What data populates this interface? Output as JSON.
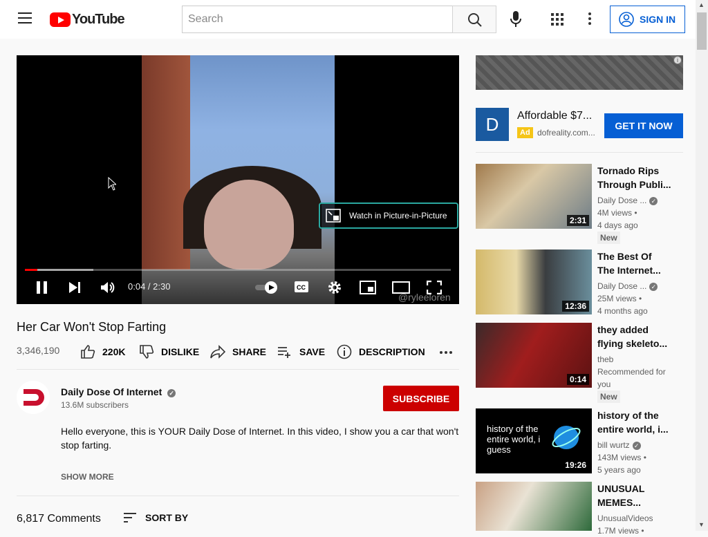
{
  "header": {
    "logo_text": "YouTube",
    "search_placeholder": "Search",
    "signin_label": "SIGN IN"
  },
  "player": {
    "time_display": "0:04 / 2:30",
    "pip_label": "Watch in Picture-in-Picture",
    "watermark": "@ryleeloren",
    "progress_played": 0.03,
    "progress_buffered": 0.16
  },
  "video": {
    "title": "Her Car Won't Stop Farting",
    "views": "3,346,190",
    "like_count": "220K",
    "dislike_label": "DISLIKE",
    "share_label": "SHARE",
    "save_label": "SAVE",
    "description_label": "DESCRIPTION"
  },
  "channel": {
    "name": "Daily Dose Of Internet",
    "subscribers": "13.6M subscribers",
    "subscribe_label": "SUBSCRIBE",
    "description": "Hello everyone, this is YOUR Daily Dose of Internet. In this video, I show you a car that won't stop farting.",
    "show_more": "SHOW MORE"
  },
  "comments": {
    "count": "6,817 Comments",
    "sort_label": "SORT BY"
  },
  "ad": {
    "logo_letter": "D",
    "title": "Affordable $7...",
    "tag": "Ad",
    "url": "dofreality.com...",
    "button_label": "GET IT NOW"
  },
  "related": [
    {
      "title1": "Tornado Rips",
      "title2": "Through Publi...",
      "channel": "Daily Dose ...",
      "views": "4M views",
      "age": "4 days ago",
      "duration": "2:31",
      "badge": "New"
    },
    {
      "title1": "The Best Of",
      "title2": "The Internet...",
      "channel": "Daily Dose ...",
      "views": "25M views",
      "age": "4 months ago",
      "duration": "12:36",
      "badge": ""
    },
    {
      "title1": "they added",
      "title2": "flying skeleto...",
      "channel": "theb",
      "views": "Recommended for",
      "age": "you",
      "duration": "0:14",
      "badge": "New"
    },
    {
      "title1": "history of the",
      "title2": "entire world, i...",
      "channel": "bill wurtz",
      "views": "143M views",
      "age": "5 years ago",
      "duration": "19:26",
      "badge": "",
      "thumb_text": "history of the entire world, i guess"
    },
    {
      "title1": "UNUSUAL",
      "title2": "MEMES...",
      "channel": "UnusualVideos",
      "views": "1.7M views",
      "age": "",
      "duration": "",
      "badge": ""
    }
  ]
}
